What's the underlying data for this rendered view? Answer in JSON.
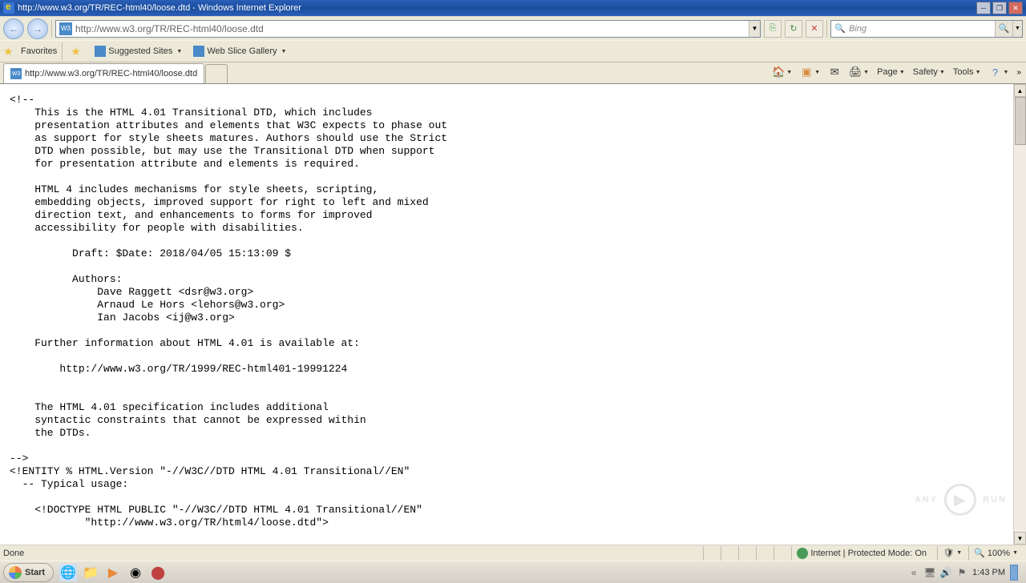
{
  "titlebar": {
    "title": "http://www.w3.org/TR/REC-html40/loose.dtd - Windows Internet Explorer"
  },
  "address": {
    "url": "http://www.w3.org/TR/REC-html40/loose.dtd",
    "iconLabel": "W3"
  },
  "search": {
    "placeholder": "Bing"
  },
  "favorites": {
    "label": "Favorites",
    "suggested": "Suggested Sites",
    "slice": "Web Slice Gallery"
  },
  "tab": {
    "title": "http://www.w3.org/TR/REC-html40/loose.dtd",
    "iconLabel": "W3"
  },
  "commandbar": {
    "page": "Page",
    "safety": "Safety",
    "tools": "Tools"
  },
  "status": {
    "done": "Done",
    "zone": "Internet | Protected Mode: On",
    "zoom": "100%"
  },
  "taskbar": {
    "start": "Start",
    "time": "1:43 PM"
  },
  "content": "<!--\n    This is the HTML 4.01 Transitional DTD, which includes\n    presentation attributes and elements that W3C expects to phase out\n    as support for style sheets matures. Authors should use the Strict\n    DTD when possible, but may use the Transitional DTD when support\n    for presentation attribute and elements is required.\n\n    HTML 4 includes mechanisms for style sheets, scripting,\n    embedding objects, improved support for right to left and mixed\n    direction text, and enhancements to forms for improved\n    accessibility for people with disabilities.\n\n          Draft: $Date: 2018/04/05 15:13:09 $\n\n          Authors:\n              Dave Raggett <dsr@w3.org>\n              Arnaud Le Hors <lehors@w3.org>\n              Ian Jacobs <ij@w3.org>\n\n    Further information about HTML 4.01 is available at:\n\n        http://www.w3.org/TR/1999/REC-html401-19991224\n\n\n    The HTML 4.01 specification includes additional\n    syntactic constraints that cannot be expressed within\n    the DTDs.\n\n-->\n<!ENTITY % HTML.Version \"-//W3C//DTD HTML 4.01 Transitional//EN\"\n  -- Typical usage:\n\n    <!DOCTYPE HTML PUBLIC \"-//W3C//DTD HTML 4.01 Transitional//EN\"\n            \"http://www.w3.org/TR/html4/loose.dtd\">",
  "watermark": {
    "text": "ANY",
    "text2": "RUN"
  }
}
